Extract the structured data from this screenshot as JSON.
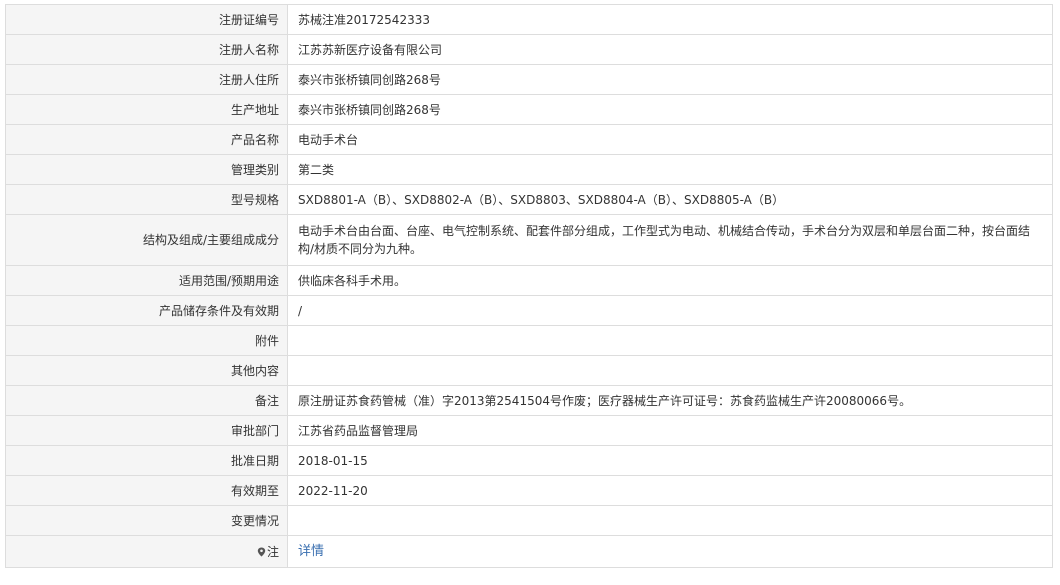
{
  "rows": [
    {
      "label": "注册证编号",
      "value": "苏械注准20172542333"
    },
    {
      "label": "注册人名称",
      "value": "江苏苏新医疗设备有限公司"
    },
    {
      "label": "注册人住所",
      "value": "泰兴市张桥镇同创路268号"
    },
    {
      "label": "生产地址",
      "value": "泰兴市张桥镇同创路268号"
    },
    {
      "label": "产品名称",
      "value": "电动手术台"
    },
    {
      "label": "管理类别",
      "value": "第二类"
    },
    {
      "label": "型号规格",
      "value": "SXD8801-A（B）、SXD8802-A（B）、SXD8803、SXD8804-A（B）、SXD8805-A（B）"
    },
    {
      "label": "结构及组成/主要组成成分",
      "value": "电动手术台由台面、台座、电气控制系统、配套件部分组成，工作型式为电动、机械结合传动，手术台分为双层和单层台面二种，按台面结构/材质不同分为九种。"
    },
    {
      "label": "适用范围/预期用途",
      "value": "供临床各科手术用。"
    },
    {
      "label": "产品储存条件及有效期",
      "value": "/"
    },
    {
      "label": "附件",
      "value": ""
    },
    {
      "label": "其他内容",
      "value": ""
    },
    {
      "label": "备注",
      "value": "原注册证苏食药管械（准）字2013第2541504号作废；医疗器械生产许可证号：苏食药监械生产许20080066号。"
    },
    {
      "label": "审批部门",
      "value": "江苏省药品监督管理局"
    },
    {
      "label": "批准日期",
      "value": "2018-01-15"
    },
    {
      "label": "有效期至",
      "value": "2022-11-20"
    },
    {
      "label": "变更情况",
      "value": ""
    }
  ],
  "note": {
    "label": "注",
    "icon": "map-pin-icon",
    "link_text": "详情"
  },
  "colors": {
    "label_bg": "#f5f5f5",
    "border": "#dddddd",
    "link": "#3a6fb0"
  }
}
